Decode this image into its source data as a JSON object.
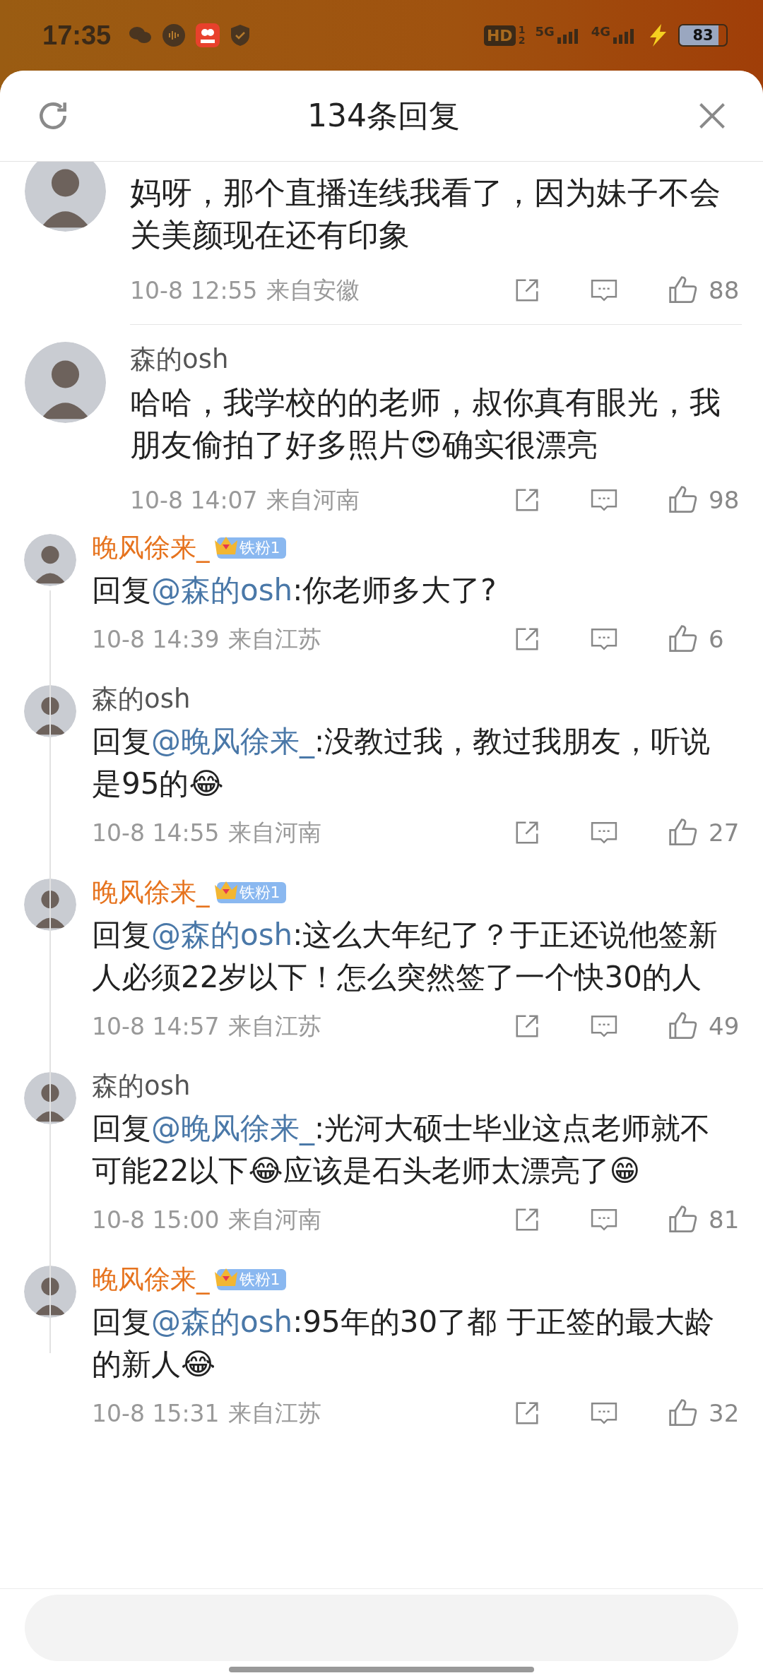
{
  "status_bar": {
    "time": "17:35",
    "hd": "HD",
    "sim_labels": [
      "1",
      "2"
    ],
    "networks": [
      "5G",
      "4G"
    ],
    "battery": "83"
  },
  "header": {
    "title": "134条回复"
  },
  "comments": [
    {
      "text": "妈呀，那个直播连线我看了，因为妹子不会关美颜现在还有印象",
      "time": "10-8 12:55",
      "location": "来自安徽",
      "likes": "88"
    },
    {
      "name": "森的osh",
      "text": "哈哈，我学校的的老师，叔你真有眼光，我朋友偷拍了好多照片😍确实很漂亮",
      "time": "10-8 14:07",
      "location": "来自河南",
      "likes": "98",
      "replies": [
        {
          "name": "晚风徐来_",
          "fan": true,
          "badge": "铁粉1",
          "prefix": "回复",
          "mention": "@森的osh",
          "text": ":你老师多大了?",
          "time": "10-8 14:39",
          "location": "来自江苏",
          "likes": "6"
        },
        {
          "name": "森的osh",
          "fan": false,
          "prefix": "回复",
          "mention": "@晚风徐来_",
          "text": ":没教过我，教过我朋友，听说是95的😂",
          "time": "10-8 14:55",
          "location": "来自河南",
          "likes": "27"
        },
        {
          "name": "晚风徐来_",
          "fan": true,
          "badge": "铁粉1",
          "prefix": "回复",
          "mention": "@森的osh",
          "text": ":这么大年纪了？于正还说他签新人必须22岁以下！怎么突然签了一个快30的人",
          "time": "10-8 14:57",
          "location": "来自江苏",
          "likes": "49"
        },
        {
          "name": "森的osh",
          "fan": false,
          "prefix": "回复",
          "mention": "@晚风徐来_",
          "text": ":光河大硕士毕业这点老师就不可能22以下😂应该是石头老师太漂亮了😁",
          "time": "10-8 15:00",
          "location": "来自河南",
          "likes": "81"
        },
        {
          "name": "晚风徐来_",
          "fan": true,
          "badge": "铁粉1",
          "prefix": "回复",
          "mention": "@森的osh",
          "text": ":95年的30了都 于正签的最大龄的新人😂",
          "time": "10-8 15:31",
          "location": "来自江苏",
          "likes": "32"
        }
      ]
    }
  ],
  "input": {
    "kind": "field"
  }
}
